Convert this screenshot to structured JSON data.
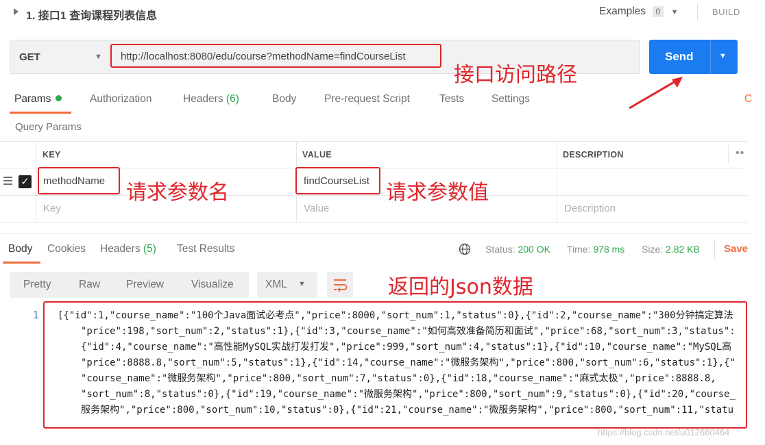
{
  "request": {
    "name": "1. 接口1 查询课程列表信息",
    "examples_label": "Examples",
    "examples_count": "0",
    "build_label": "BUILD",
    "method": "GET",
    "url": "http://localhost:8080/edu/course?methodName=findCourseList",
    "send_label": "Send"
  },
  "request_tabs": [
    {
      "label": "Params"
    },
    {
      "label": "Authorization"
    },
    {
      "label": "Headers",
      "count": "(6)"
    },
    {
      "label": "Body"
    },
    {
      "label": "Pre-request Script"
    },
    {
      "label": "Tests"
    },
    {
      "label": "Settings"
    }
  ],
  "query_params": {
    "title": "Query Params",
    "headers": {
      "key": "KEY",
      "value": "VALUE",
      "description": "DESCRIPTION"
    },
    "rows": [
      {
        "key": "methodName",
        "value": "findCourseList",
        "checked": true
      }
    ],
    "placeholder": {
      "key": "Key",
      "value": "Value",
      "description": "Description"
    }
  },
  "response": {
    "tabs": [
      {
        "label": "Body"
      },
      {
        "label": "Cookies"
      },
      {
        "label": "Headers",
        "count": "(5)"
      },
      {
        "label": "Test Results"
      }
    ],
    "status_label": "Status:",
    "status_value": "200 OK",
    "time_label": "Time:",
    "time_value": "978 ms",
    "size_label": "Size:",
    "size_value": "2.82 KB",
    "save_label": "Save",
    "view_modes": [
      "Pretty",
      "Raw",
      "Preview",
      "Visualize"
    ],
    "format": "XML",
    "line_number": "1",
    "body_lines": [
      "[{\"id\":1,\"course_name\":\"100个Java面试必考点\",\"price\":8000,\"sort_num\":1,\"status\":0},{\"id\":2,\"course_name\":\"300分钟搞定算法",
      "\"price\":198,\"sort_num\":2,\"status\":1},{\"id\":3,\"course_name\":\"如何高效准备简历和面试\",\"price\":68,\"sort_num\":3,\"status\":",
      "{\"id\":4,\"course_name\":\"高性能MySQL实战打发打发\",\"price\":999,\"sort_num\":4,\"status\":1},{\"id\":10,\"course_name\":\"MySQL高",
      "\"price\":8888.8,\"sort_num\":5,\"status\":1},{\"id\":14,\"course_name\":\"微服务架构\",\"price\":800,\"sort_num\":6,\"status\":1},{\"",
      "\"course_name\":\"微服务架构\",\"price\":800,\"sort_num\":7,\"status\":0},{\"id\":18,\"course_name\":\"麻式太极\",\"price\":8888.8,",
      "\"sort_num\":8,\"status\":0},{\"id\":19,\"course_name\":\"微服务架构\",\"price\":800,\"sort_num\":9,\"status\":0},{\"id\":20,\"course_",
      "服务架构\",\"price\":800,\"sort_num\":10,\"status\":0},{\"id\":21,\"course_name\":\"微服务架构\",\"price\":800,\"sort_num\":11,\"statu"
    ]
  },
  "annotations": {
    "url": "接口访问路径",
    "param_name": "请求参数名",
    "param_value": "请求参数值",
    "json": "返回的Json数据"
  },
  "watermark": "https://blog.csdn.net/u012660464",
  "colors": {
    "accent": "#f26b3a",
    "send": "#1a7cf0",
    "annotation": "#e0252b",
    "status_ok": "#2fa84f"
  }
}
